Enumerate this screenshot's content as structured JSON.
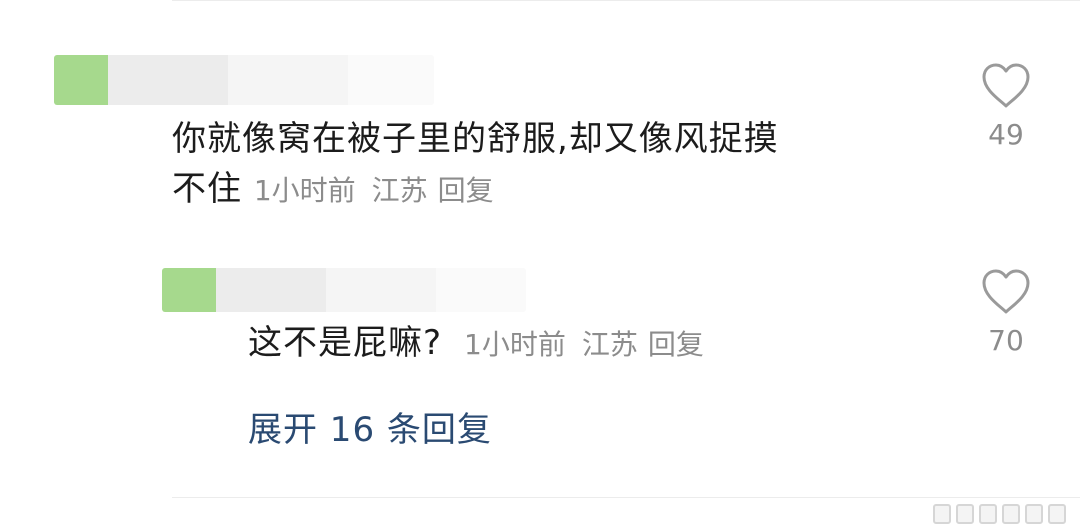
{
  "comments": [
    {
      "text_line1": "你就像窝在被子里的舒服,却又像风捉摸",
      "text_line2": "不住",
      "time": "1小时前",
      "location": "江苏",
      "reply_label": "回复",
      "likes": "49"
    }
  ],
  "replies": [
    {
      "text": "这不是屁嘛?",
      "time": "1小时前",
      "location": "江苏",
      "reply_label": "回复",
      "likes": "70"
    }
  ],
  "expand_label": "展开 16 条回复",
  "icons": {
    "like": "heart-outline-icon"
  },
  "colors": {
    "text": "#1c1c1c",
    "meta": "#8c8c8c",
    "link": "#2a4a72",
    "icon": "#9a9a9a"
  }
}
